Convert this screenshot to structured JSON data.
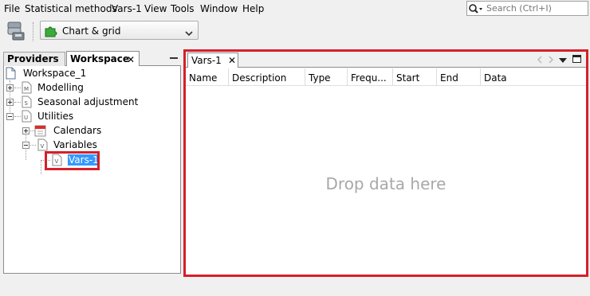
{
  "menubar": {
    "items": [
      "File",
      "Statistical methods",
      "Vars-1",
      "View",
      "Tools",
      "Window",
      "Help"
    ],
    "search_placeholder": "Search (Ctrl+I)"
  },
  "toolbar": {
    "view_combo_value": "Chart & grid"
  },
  "left_panel": {
    "tabs": [
      {
        "label": "Providers"
      },
      {
        "label": "Workspace",
        "close": "✕"
      }
    ],
    "minimize": "—",
    "tree": {
      "root": {
        "label": "Workspace_1"
      },
      "items": [
        {
          "label": "Modelling",
          "badge": "M"
        },
        {
          "label": "Seasonal adjustment",
          "badge": "S"
        },
        {
          "label": "Utilities",
          "badge": "U"
        },
        {
          "label": "Calendars"
        },
        {
          "label": "Variables",
          "badge": "V"
        },
        {
          "label": "Vars-1",
          "badge": "V"
        }
      ]
    }
  },
  "right_panel": {
    "doc_tab": {
      "label": "Vars-1",
      "close": "✕"
    },
    "columns": [
      "Name",
      "Description",
      "Type",
      "Frequ...",
      "Start",
      "End",
      "Data"
    ],
    "empty_message": "Drop data here"
  },
  "colors": {
    "highlight_frame": "#d4202a",
    "selection": "#3399ff"
  }
}
